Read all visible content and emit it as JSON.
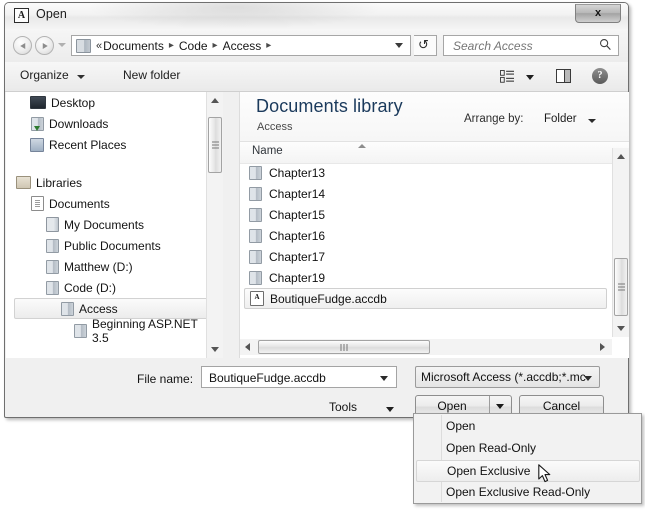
{
  "window": {
    "title": "Open",
    "app_icon": "A",
    "close_label": "x"
  },
  "navbar": {
    "back_icon": "back-arrow-icon",
    "forward_icon": "forward-arrow-icon",
    "history_icon": "chevron-down-icon",
    "breadcrumb_overflow": "«",
    "breadcrumbs": [
      {
        "label": "Documents"
      },
      {
        "label": "Code"
      },
      {
        "label": "Access"
      }
    ],
    "separator": "▸",
    "refresh_icon": "refresh-icon",
    "refresh_glyph": "↺",
    "search_placeholder": "Search Access",
    "search_value": "",
    "search_icon": "search-icon"
  },
  "toolbar": {
    "organize_label": "Organize",
    "new_folder_label": "New folder",
    "view_icon": "view-list-icon",
    "preview_pane_icon": "preview-pane-icon",
    "help_icon": "help-icon",
    "help_glyph": "?"
  },
  "sidebar": {
    "items": [
      {
        "label": "Desktop",
        "icon": "monitor-icon",
        "indent": 23,
        "selected": false
      },
      {
        "label": "Downloads",
        "icon": "download-folder-icon",
        "indent": 23,
        "selected": false
      },
      {
        "label": "Recent Places",
        "icon": "recent-places-icon",
        "indent": 23,
        "selected": false
      },
      {
        "label": "Libraries",
        "icon": "libraries-folder-icon",
        "indent": 9,
        "selected": false
      },
      {
        "label": "Documents",
        "icon": "document-icon",
        "indent": 23,
        "selected": false
      },
      {
        "label": "My Documents",
        "icon": "my-documents-icon",
        "indent": 38,
        "selected": false
      },
      {
        "label": "Public Documents",
        "icon": "folder-icon",
        "indent": 38,
        "selected": false
      },
      {
        "label": "Matthew (D:)",
        "icon": "folder-icon",
        "indent": 38,
        "selected": false
      },
      {
        "label": "Code (D:)",
        "icon": "folder-icon",
        "indent": 38,
        "selected": false
      },
      {
        "label": "Access",
        "icon": "folder-icon",
        "indent": 52,
        "selected": true
      },
      {
        "label": "Beginning ASP.NET 3.5",
        "icon": "folder-icon",
        "indent": 66,
        "selected": false
      }
    ]
  },
  "file_pane": {
    "library_title": "Documents library",
    "library_subtitle": "Access",
    "arrange_label": "Arrange by:",
    "arrange_value": "Folder",
    "column_header": "Name",
    "files": [
      {
        "name": "Chapter13",
        "type": "folder",
        "selected": false
      },
      {
        "name": "Chapter14",
        "type": "folder",
        "selected": false
      },
      {
        "name": "Chapter15",
        "type": "folder",
        "selected": false
      },
      {
        "name": "Chapter16",
        "type": "folder",
        "selected": false
      },
      {
        "name": "Chapter17",
        "type": "folder",
        "selected": false
      },
      {
        "name": "Chapter19",
        "type": "folder",
        "selected": false
      },
      {
        "name": "BoutiqueFudge.accdb",
        "type": "accdb",
        "selected": true
      }
    ]
  },
  "form": {
    "filename_label": "File name:",
    "filename_value": "BoutiqueFudge.accdb",
    "filetype_value": "Microsoft Access (*.accdb;*.mdb)",
    "filetype_display": "Microsoft Access (*.accdb;*.mc",
    "tools_label": "Tools",
    "open_label": "Open",
    "cancel_label": "Cancel"
  },
  "context_menu": {
    "items": [
      {
        "label": "Open",
        "highlight": false
      },
      {
        "label": "Open Read-Only",
        "highlight": false
      },
      {
        "label": "Open Exclusive",
        "highlight": true
      },
      {
        "label": "Open Exclusive Read-Only",
        "highlight": false
      }
    ]
  },
  "colors": {
    "window_bg": "#f0f0f0",
    "library_title": "#1b3a5c",
    "border": "#6f6f6f",
    "selection_fill": "#efefef"
  }
}
